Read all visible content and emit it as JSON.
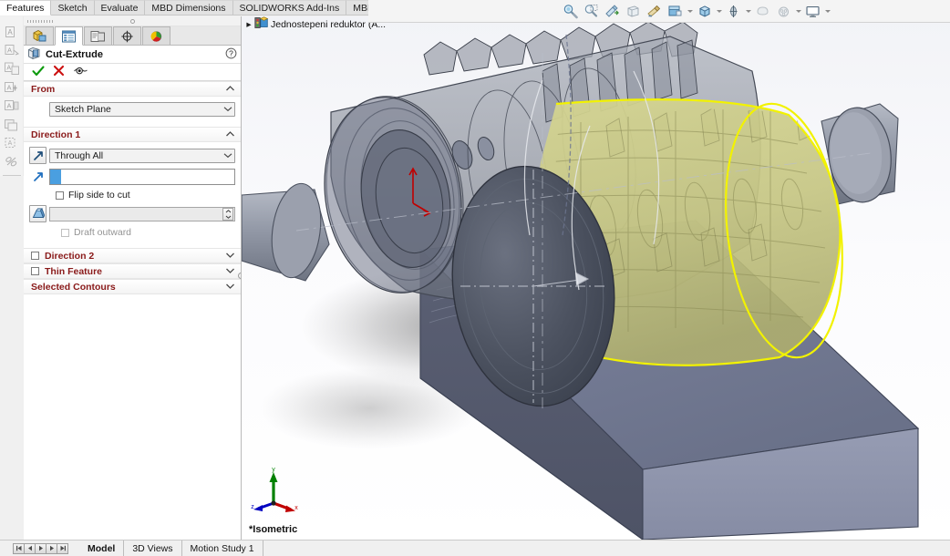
{
  "ribbon": {
    "tabs": [
      {
        "label": "Features",
        "active": true
      },
      {
        "label": "Sketch",
        "active": false
      },
      {
        "label": "Evaluate",
        "active": false
      },
      {
        "label": "MBD Dimensions",
        "active": false
      },
      {
        "label": "SOLIDWORKS Add-Ins",
        "active": false
      },
      {
        "label": "MBD",
        "active": false
      }
    ]
  },
  "view_toolbar": {
    "buttons": [
      {
        "name": "zoom-to-fit-icon",
        "dropdown": false
      },
      {
        "name": "zoom-to-area-icon",
        "dropdown": false
      },
      {
        "name": "previous-view-icon",
        "dropdown": false
      },
      {
        "name": "section-view-icon",
        "dropdown": false
      },
      {
        "name": "view-orientation-icon",
        "dropdown": false
      },
      {
        "name": "display-style-icon",
        "dropdown": true
      },
      {
        "name": "hide-show-items-icon",
        "dropdown": true
      },
      {
        "name": "edit-appearance-icon",
        "dropdown": true
      },
      {
        "name": "apply-scene-icon",
        "dropdown": false
      },
      {
        "name": "view-settings-icon",
        "dropdown": true
      },
      {
        "name": "display-manager-icon",
        "dropdown": true
      }
    ]
  },
  "annotation_toolbar": {
    "items": [
      {
        "name": "note-icon"
      },
      {
        "name": "balloon-icon"
      },
      {
        "name": "auto-balloon-icon"
      },
      {
        "name": "surface-finish-icon"
      },
      {
        "name": "weld-symbol-icon"
      },
      {
        "name": "area-hatch-icon"
      },
      {
        "name": "block-icon"
      }
    ]
  },
  "property_manager": {
    "tabs": [
      {
        "name": "feature-manager-tab",
        "active": false
      },
      {
        "name": "property-manager-tab",
        "active": true
      },
      {
        "name": "configuration-manager-tab",
        "active": false
      },
      {
        "name": "dimxpert-manager-tab",
        "active": false
      },
      {
        "name": "display-manager-tab",
        "active": false
      }
    ],
    "title": "Cut-Extrude",
    "help_icon": "help-icon",
    "actions": [
      {
        "name": "ok-button",
        "glyph": "✓"
      },
      {
        "name": "cancel-button",
        "glyph": "✕"
      },
      {
        "name": "preview-button",
        "glyph": "eye"
      }
    ],
    "sections": {
      "from": {
        "title": "From",
        "condition_value": "Sketch Plane"
      },
      "direction1": {
        "title": "Direction 1",
        "end_condition_value": "Through All",
        "selection_value": "",
        "flip_side_label": "Flip side to cut",
        "flip_side_checked": false,
        "draft_angle_value": "",
        "draft_outward_label": "Draft outward",
        "draft_outward_checked": false,
        "draft_outward_enabled": false
      },
      "direction2": {
        "title": "Direction 2",
        "checked": false
      },
      "thin_feature": {
        "title": "Thin Feature",
        "checked": false
      },
      "selected_contours": {
        "title": "Selected Contours"
      }
    }
  },
  "feature_tree": {
    "root_label": "Jednostepeni reduktor  (A...",
    "expander": "▸",
    "icon": "assembly-icon"
  },
  "viewport": {
    "view_label": "*Isometric",
    "triad": {
      "x_label": "x",
      "y_label": "y",
      "z_label": "z",
      "x_color": "#c00000",
      "y_color": "#008000",
      "z_color": "#0000c0"
    },
    "colors": {
      "background_top": "#f2f3f7",
      "background_bottom": "#ffffff",
      "housing_light": "#8e94ab",
      "housing_dark": "#565c70",
      "gear_gray": "#8f949c",
      "sketch_fill": "#c9c98a",
      "sketch_outline": "#f2f200",
      "origin_red": "#c00000",
      "origin_marker_green": "#2fbf2f"
    }
  },
  "status_bar": {
    "play_controls": [
      {
        "name": "first-frame-button",
        "glyph": "⏮"
      },
      {
        "name": "prev-frame-button",
        "glyph": "◀"
      },
      {
        "name": "play-button",
        "glyph": "▶"
      },
      {
        "name": "next-frame-button",
        "glyph": "▶"
      },
      {
        "name": "last-frame-button",
        "glyph": "⏭"
      }
    ],
    "doc_tabs": [
      {
        "label": "Model",
        "active": true
      },
      {
        "label": "3D Views",
        "active": false
      },
      {
        "label": "Motion Study 1",
        "active": false
      }
    ]
  }
}
